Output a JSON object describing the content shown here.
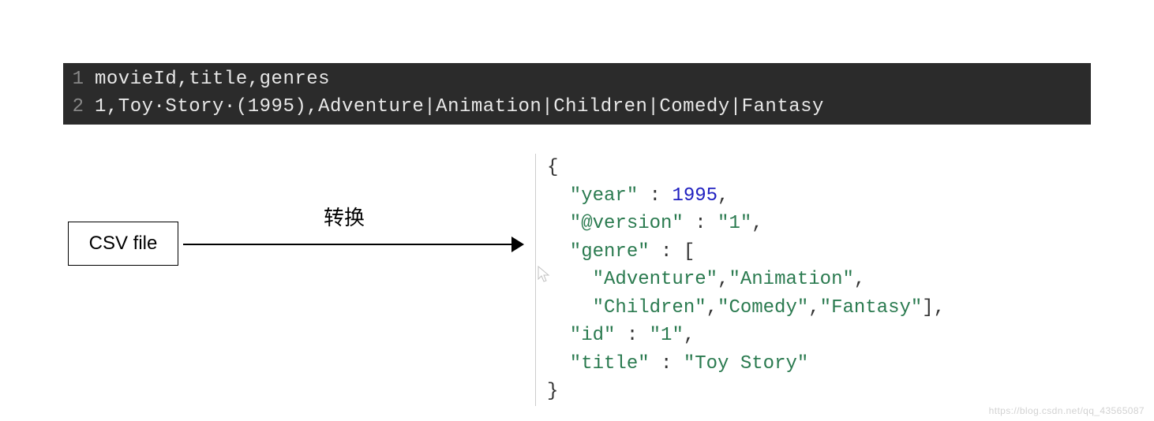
{
  "code": {
    "line1_num": "1",
    "line1_text": "movieId,title,genres",
    "line2_num": "2",
    "line2_text": "1,Toy·Story·(1995),Adventure|Animation|Children|Comedy|Fantasy"
  },
  "csv_box": {
    "label": "CSV file"
  },
  "arrow": {
    "label": "转换"
  },
  "json": {
    "l1": "{",
    "l2a": "  \"year\"",
    "l2b": " : ",
    "l2c": "1995",
    "l2d": ",",
    "l3a": "  \"@version\"",
    "l3b": " : ",
    "l3c": "\"1\"",
    "l3d": ",",
    "l4a": "  \"genre\"",
    "l4b": " : [",
    "l5a": "    \"Adventure\"",
    "l5b": ",",
    "l5c": "\"Animation\"",
    "l5d": ",",
    "l6a": "    \"Children\"",
    "l6b": ",",
    "l6c": "\"Comedy\"",
    "l6d": ",",
    "l6e": "\"Fantasy\"",
    "l6f": "],",
    "l7a": "  \"id\"",
    "l7b": " : ",
    "l7c": "\"1\"",
    "l7d": ",",
    "l8a": "  \"title\"",
    "l8b": " : ",
    "l8c": "\"Toy Story\"",
    "l9": "}"
  },
  "watermark": "https://blog.csdn.net/qq_43565087"
}
